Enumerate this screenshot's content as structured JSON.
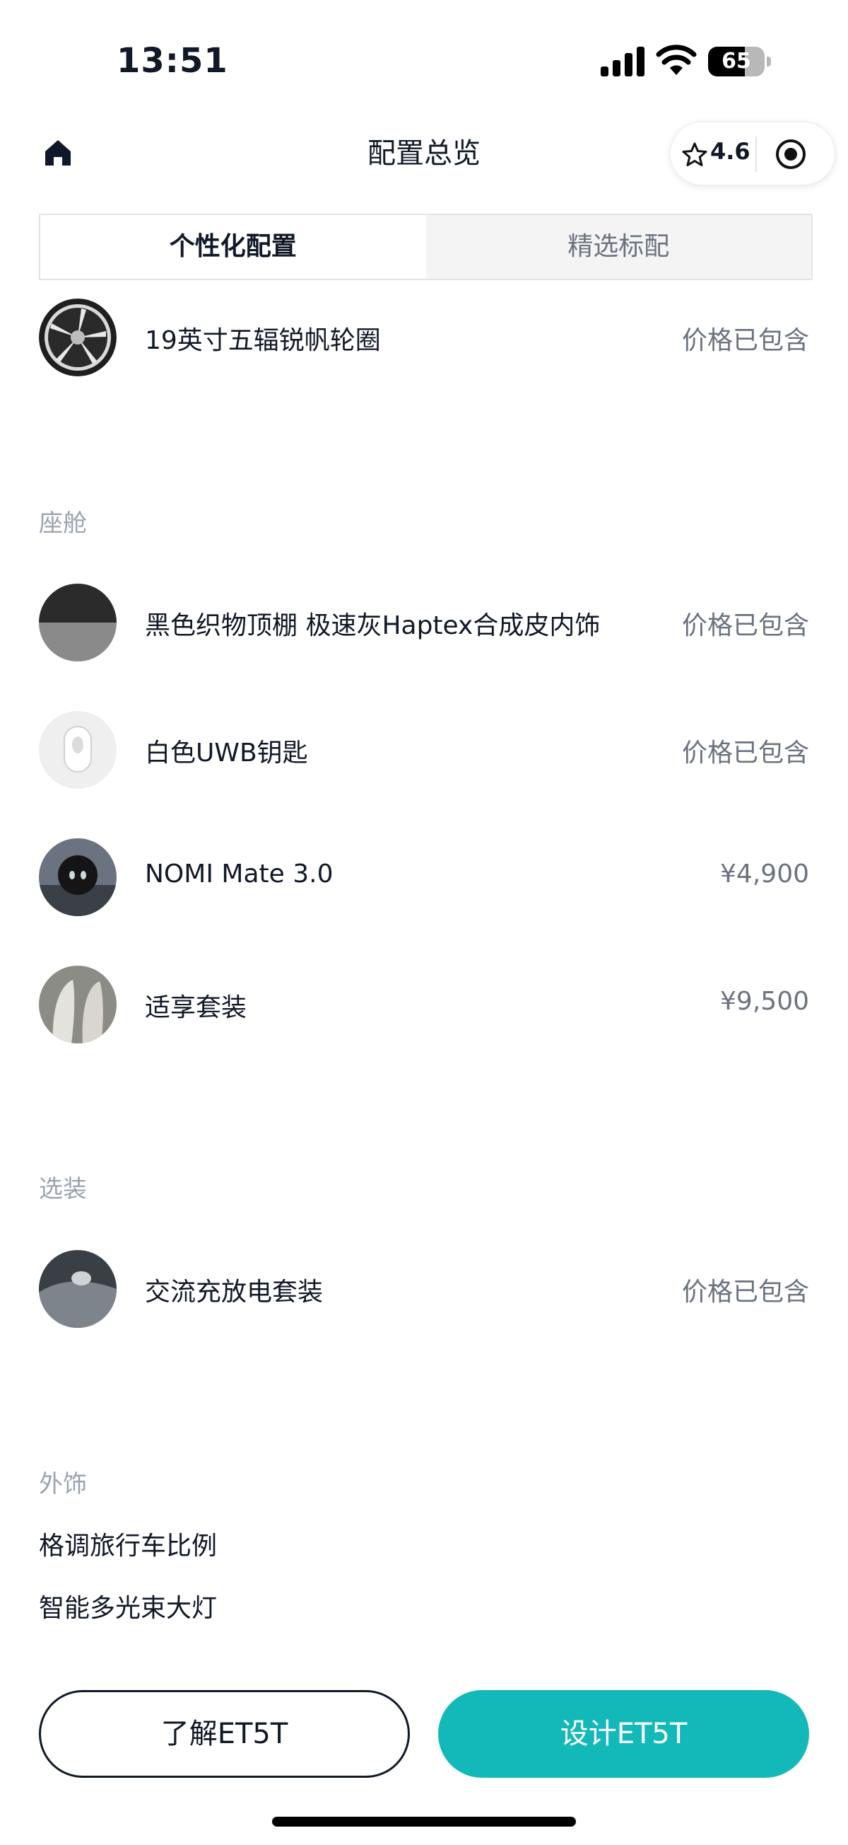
{
  "status_bar": {
    "time": "13:51",
    "battery_level": "65",
    "battery_fraction": 0.65
  },
  "nav": {
    "title": "配置总览",
    "rating": "4.6"
  },
  "tabs": [
    {
      "label": "个性化配置",
      "active": true
    },
    {
      "label": "精选标配",
      "active": false
    }
  ],
  "wheel_item": {
    "name": "19英寸五辐锐帆轮圈",
    "price": "价格已包含",
    "icon": "wheel-thumbnail"
  },
  "sections": {
    "cabin": {
      "title": "座舱",
      "items": [
        {
          "name": "黑色织物顶棚 极速灰Haptex合成皮内饰",
          "price": "价格已包含",
          "icon": "interior-swatch-thumbnail"
        },
        {
          "name": "白色UWB钥匙",
          "price": "价格已包含",
          "icon": "key-thumbnail"
        },
        {
          "name": "NOMI Mate 3.0",
          "price": "¥4,900",
          "icon": "nomi-thumbnail"
        },
        {
          "name": "适享套装",
          "price": "¥9,500",
          "icon": "seat-thumbnail"
        }
      ]
    },
    "options": {
      "title": "选装",
      "items": [
        {
          "name": "交流充放电套装",
          "price": "价格已包含",
          "icon": "charger-thumbnail"
        }
      ]
    },
    "exterior": {
      "title": "外饰",
      "features": [
        "格调旅行车比例",
        "智能多光束大灯"
      ]
    }
  },
  "buttons": {
    "learn": "了解ET5T",
    "design": "设计ET5T"
  },
  "colors": {
    "accent": "#13b9b9",
    "text": "#111827",
    "muted": "#6b7280"
  }
}
